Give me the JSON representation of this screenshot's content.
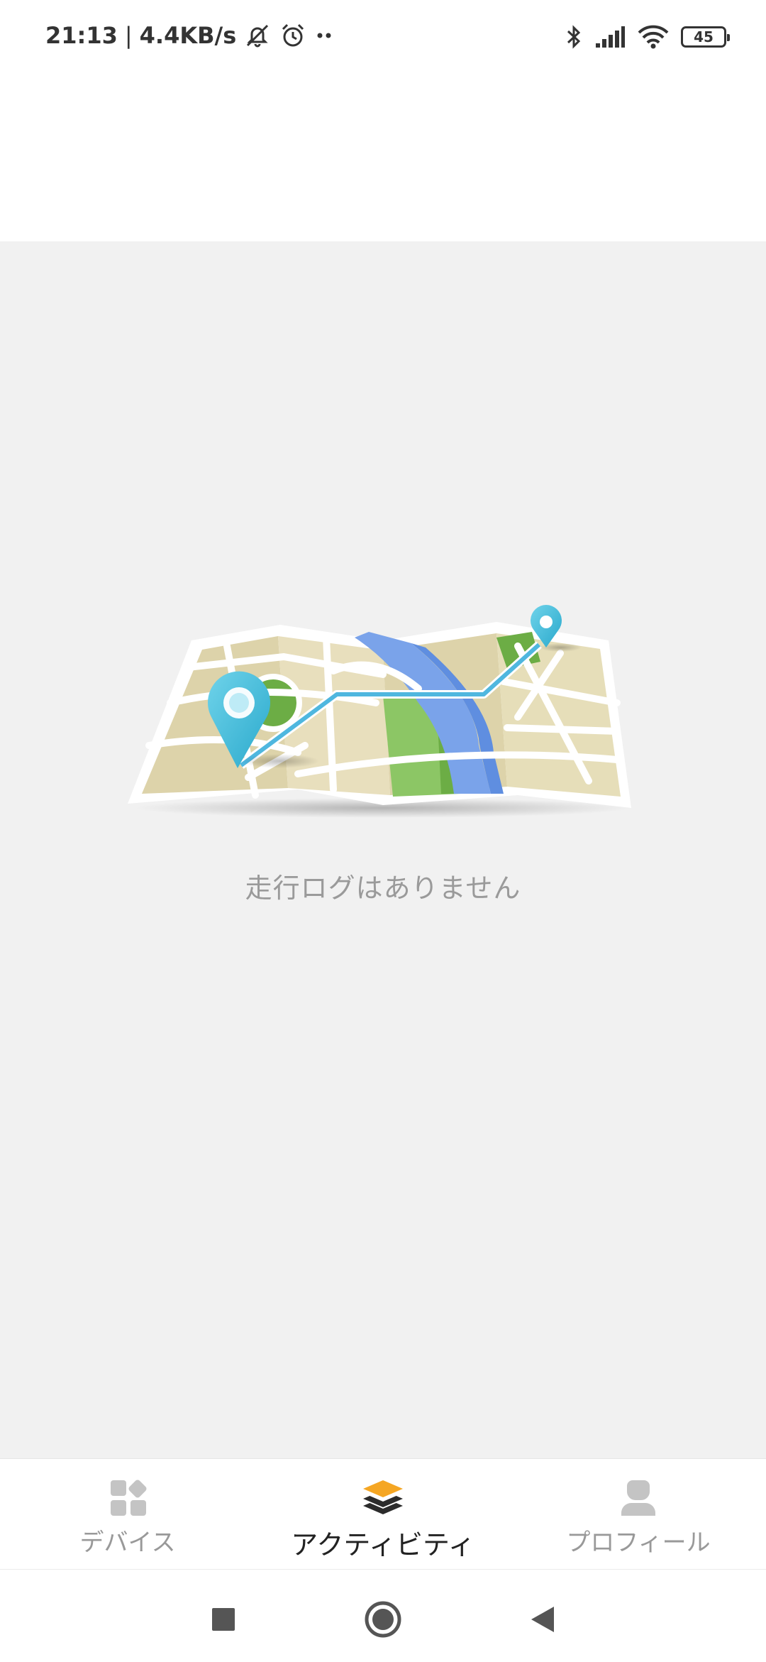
{
  "status_bar": {
    "time": "21:13",
    "separator": "|",
    "net_speed": "4.4KB/s",
    "battery_level": "45",
    "icons": [
      "notifications-muted-icon",
      "alarm-icon",
      "more-dots-icon",
      "bluetooth-icon",
      "signal-icon",
      "wifi-icon",
      "battery-icon"
    ]
  },
  "main": {
    "empty_message": "走行ログはありません",
    "illustration": "route-map-illustration"
  },
  "bottom_nav": {
    "items": [
      {
        "label": "デバイス",
        "icon": "devices-grid-icon",
        "active": false
      },
      {
        "label": "アクティビティ",
        "icon": "layers-activity-icon",
        "active": true
      },
      {
        "label": "プロフィール",
        "icon": "person-profile-icon",
        "active": false
      }
    ]
  },
  "system_nav": {
    "buttons": [
      "recents-square-icon",
      "home-circle-icon",
      "back-triangle-icon"
    ]
  },
  "colors": {
    "background": "#f1f1f1",
    "active_tab_icon_top": "#f5a623",
    "inactive_tab": "#999999",
    "empty_text": "#9a9a9a"
  }
}
